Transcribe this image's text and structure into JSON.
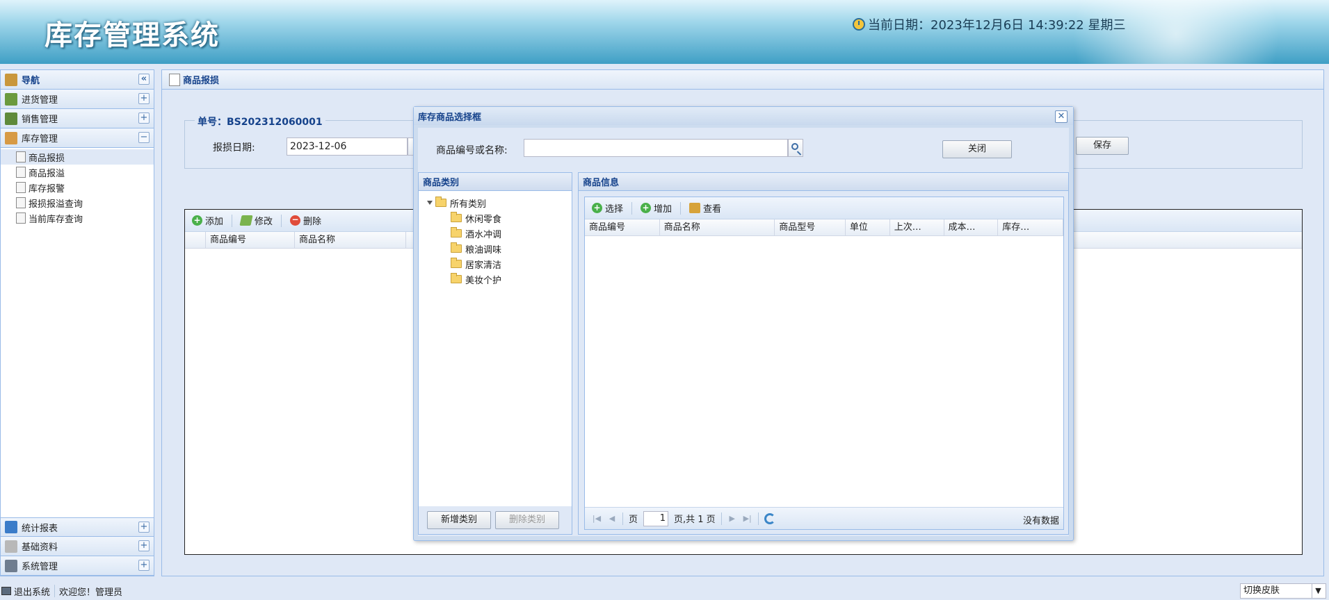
{
  "header": {
    "app_title": "库存管理系统",
    "clock_text": "当前日期：2023年12月6日 14:39:22 星期三"
  },
  "sidebar": {
    "nav_title": "导航",
    "sections": [
      {
        "label": "进货管理",
        "toggle": "+"
      },
      {
        "label": "销售管理",
        "toggle": "+"
      },
      {
        "label": "库存管理",
        "toggle": "−"
      }
    ],
    "inventory_items": [
      "商品报损",
      "商品报溢",
      "库存报警",
      "报损报溢查询",
      "当前库存查询"
    ],
    "bottom_sections": [
      {
        "label": "统计报表",
        "toggle": "+"
      },
      {
        "label": "基础资料",
        "toggle": "+"
      },
      {
        "label": "系统管理",
        "toggle": "+"
      }
    ]
  },
  "main": {
    "title": "商品报损",
    "order_no": "单号：BS202312060001",
    "date_label": "报损日期:",
    "date_value": "2023-12-06",
    "save_label": "保存",
    "toolbar": {
      "add": "添加",
      "edit": "修改",
      "delete": "删除"
    },
    "columns": [
      "商品编号",
      "商品名称"
    ]
  },
  "dialog": {
    "title": "库存商品选择框",
    "search_label": "商品编号或名称:",
    "search_value": "",
    "close_label": "关闭",
    "category_panel": {
      "title": "商品类别",
      "root": "所有类别",
      "children": [
        "休闲零食",
        "酒水冲调",
        "粮油调味",
        "居家清洁",
        "美妆个护"
      ],
      "add_label": "新增类别",
      "delete_label": "删除类别"
    },
    "info_panel": {
      "title": "商品信息",
      "toolbar": {
        "select": "选择",
        "add": "增加",
        "view": "查看"
      },
      "columns": [
        "商品编号",
        "商品名称",
        "商品型号",
        "单位",
        "上次…",
        "成本…",
        "库存…"
      ],
      "pager": {
        "page_prefix": "页",
        "page_value": "1",
        "page_suffix": "页,共 1 页",
        "status": "没有数据"
      }
    }
  },
  "footer": {
    "logout": "退出系统",
    "welcome": "欢迎您！管理员",
    "skin_label": "切换皮肤"
  }
}
